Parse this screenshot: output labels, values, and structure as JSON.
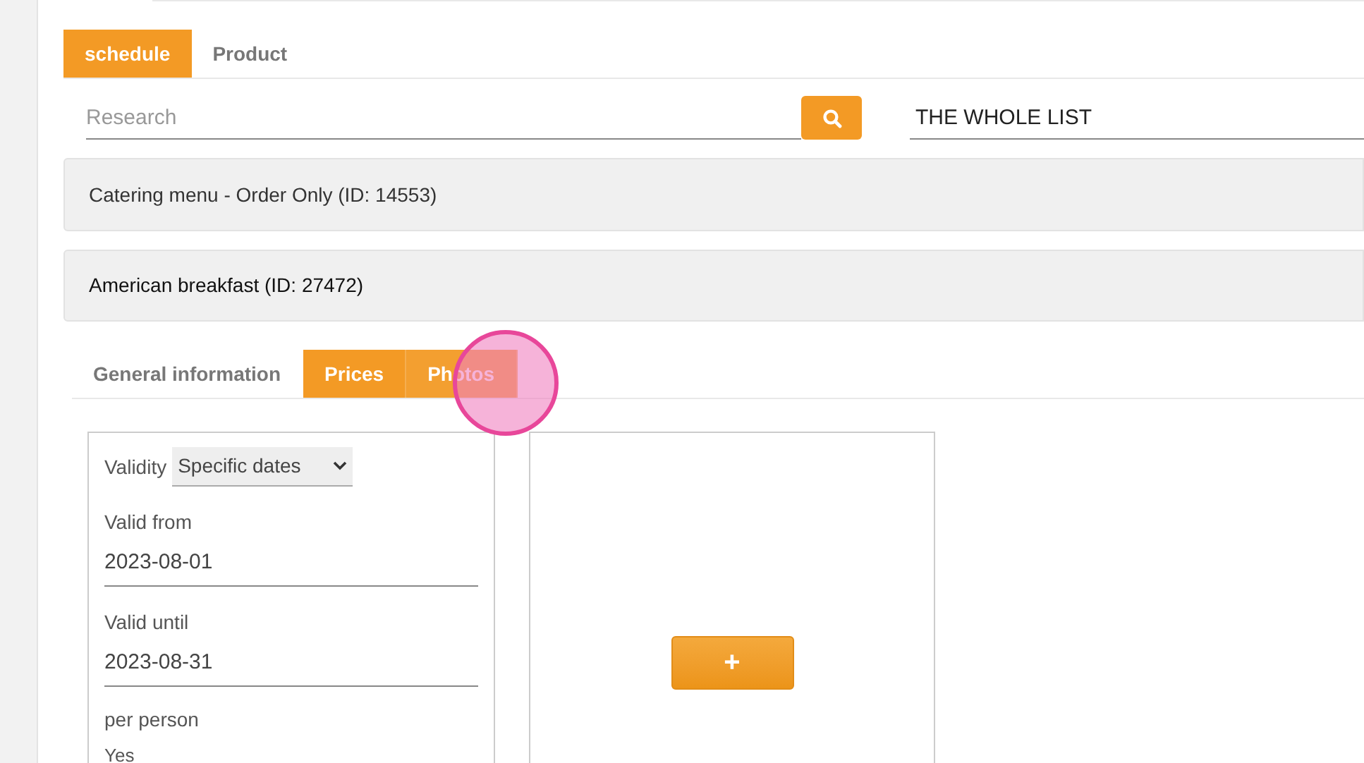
{
  "tabs": [
    {
      "label": "schedule",
      "selected": true
    },
    {
      "label": "Product",
      "selected": false
    }
  ],
  "search": {
    "placeholder": "Research"
  },
  "filter": {
    "value": "THE WHOLE LIST"
  },
  "items": [
    {
      "title": "Catering menu - Order Only (ID: 14553)",
      "expanded": false
    },
    {
      "title": "American breakfast (ID: 27472)",
      "expanded": true
    }
  ],
  "detail_tabs": [
    {
      "label": "General information",
      "selected": false,
      "hovered": false
    },
    {
      "label": "Prices",
      "selected": true,
      "hovered": false
    },
    {
      "label": "Photos",
      "selected": false,
      "hovered": true
    }
  ],
  "price_form": {
    "validity_label": "Validity",
    "validity_value": "Specific dates",
    "fields": [
      {
        "label": "Valid from",
        "value": "2023-08-01"
      },
      {
        "label": "Valid until",
        "value": "2023-08-31"
      }
    ],
    "per_person_label": "per person",
    "per_person_value": "Yes"
  },
  "add_button": {
    "label": "+"
  }
}
